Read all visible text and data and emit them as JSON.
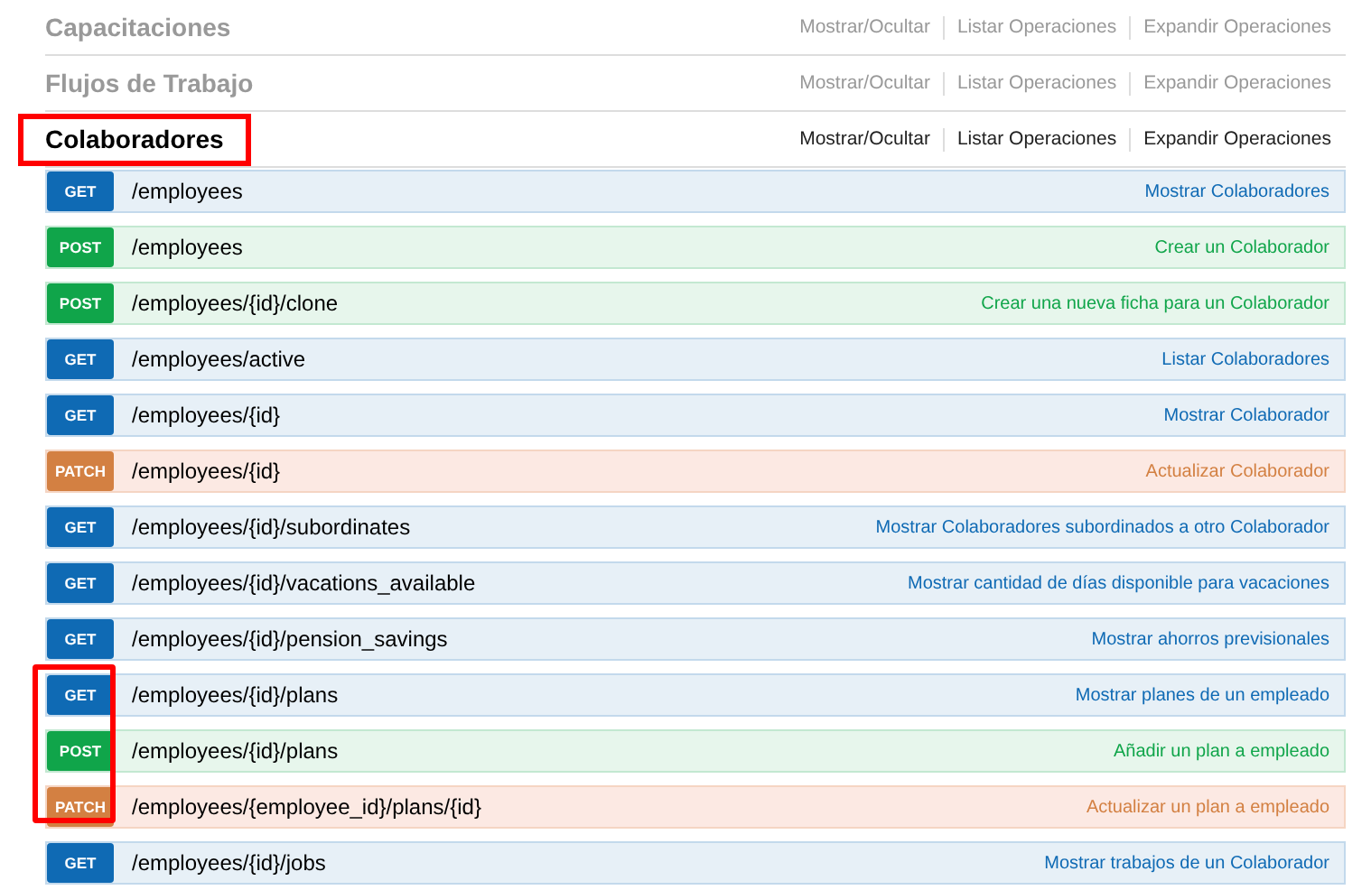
{
  "sections": [
    {
      "title": "Capacitaciones",
      "expanded": false,
      "highlighted": false,
      "links": [
        "Mostrar/Ocultar",
        "Listar Operaciones",
        "Expandir Operaciones"
      ]
    },
    {
      "title": "Flujos de Trabajo",
      "expanded": false,
      "highlighted": false,
      "links": [
        "Mostrar/Ocultar",
        "Listar Operaciones",
        "Expandir Operaciones"
      ]
    },
    {
      "title": "Colaboradores",
      "expanded": true,
      "highlighted": true,
      "links": [
        "Mostrar/Ocultar",
        "Listar Operaciones",
        "Expandir Operaciones"
      ],
      "operations": [
        {
          "method": "GET",
          "path": "/employees",
          "summary": "Mostrar Colaboradores",
          "highlighted": false
        },
        {
          "method": "POST",
          "path": "/employees",
          "summary": "Crear un Colaborador",
          "highlighted": false
        },
        {
          "method": "POST",
          "path": "/employees/{id}/clone",
          "summary": "Crear una nueva ficha para un Colaborador",
          "highlighted": false
        },
        {
          "method": "GET",
          "path": "/employees/active",
          "summary": "Listar Colaboradores",
          "highlighted": false
        },
        {
          "method": "GET",
          "path": "/employees/{id}",
          "summary": "Mostrar Colaborador",
          "highlighted": false
        },
        {
          "method": "PATCH",
          "path": "/employees/{id}",
          "summary": "Actualizar Colaborador",
          "highlighted": false
        },
        {
          "method": "GET",
          "path": "/employees/{id}/subordinates",
          "summary": "Mostrar Colaboradores subordinados a otro Colaborador",
          "highlighted": false
        },
        {
          "method": "GET",
          "path": "/employees/{id}/vacations_available",
          "summary": "Mostrar cantidad de días disponible para vacaciones",
          "highlighted": false
        },
        {
          "method": "GET",
          "path": "/employees/{id}/pension_savings",
          "summary": "Mostrar ahorros previsionales",
          "highlighted": false
        },
        {
          "method": "GET",
          "path": "/employees/{id}/plans",
          "summary": "Mostrar planes de un empleado",
          "highlighted": true
        },
        {
          "method": "POST",
          "path": "/employees/{id}/plans",
          "summary": "Añadir un plan a empleado",
          "highlighted": true
        },
        {
          "method": "PATCH",
          "path": "/employees/{employee_id}/plans/{id}",
          "summary": "Actualizar un plan a empleado",
          "highlighted": true
        },
        {
          "method": "GET",
          "path": "/employees/{id}/jobs",
          "summary": "Mostrar trabajos de un Colaborador",
          "highlighted": false
        }
      ]
    }
  ]
}
